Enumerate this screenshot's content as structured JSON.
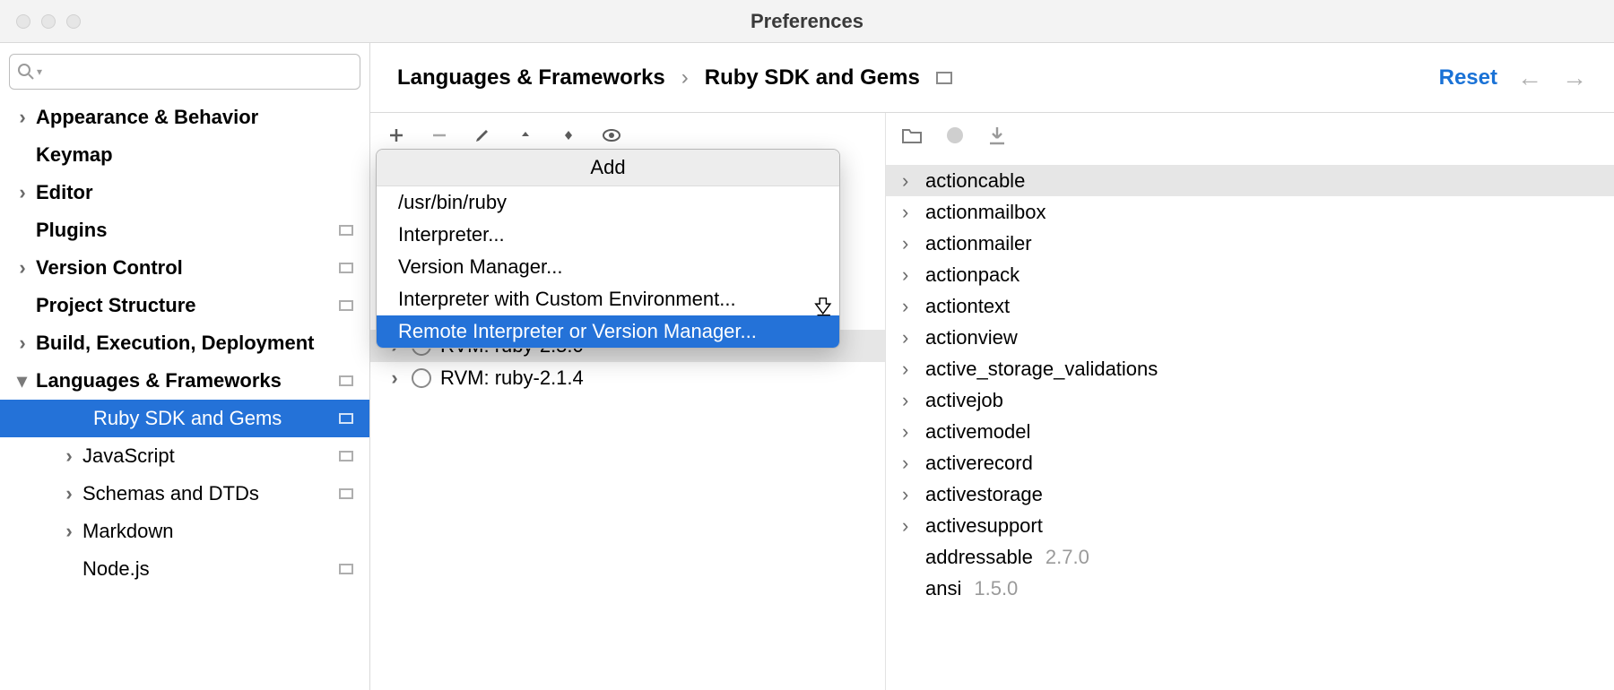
{
  "window": {
    "title": "Preferences"
  },
  "sidebar": {
    "items": [
      {
        "label": "Appearance & Behavior",
        "chevron": "right",
        "bold": true
      },
      {
        "label": "Keymap",
        "chevron": "none",
        "bold": true
      },
      {
        "label": "Editor",
        "chevron": "right",
        "bold": true
      },
      {
        "label": "Plugins",
        "chevron": "none",
        "bold": true,
        "box": true
      },
      {
        "label": "Version Control",
        "chevron": "right",
        "bold": true,
        "box": true
      },
      {
        "label": "Project Structure",
        "chevron": "none",
        "bold": true,
        "box": true
      },
      {
        "label": "Build, Execution, Deployment",
        "chevron": "right",
        "bold": true
      },
      {
        "label": "Languages & Frameworks",
        "chevron": "down",
        "bold": true,
        "box": true
      },
      {
        "label": "Ruby SDK and Gems",
        "chevron": "none",
        "selected": true,
        "box": true,
        "child": true
      },
      {
        "label": "JavaScript",
        "chevron": "right",
        "child": true,
        "box": true
      },
      {
        "label": "Schemas and DTDs",
        "chevron": "right",
        "child": true,
        "box": true
      },
      {
        "label": "Markdown",
        "chevron": "right",
        "child": true
      },
      {
        "label": "Node.js",
        "chevron": "none",
        "child": true,
        "box": true
      }
    ]
  },
  "header": {
    "crumb1": "Languages & Frameworks",
    "separator": "›",
    "crumb2": "Ruby SDK and Gems",
    "reset": "Reset"
  },
  "popup": {
    "title": "Add",
    "items": [
      {
        "label": "/usr/bin/ruby"
      },
      {
        "label": "Interpreter..."
      },
      {
        "label": "Version Manager..."
      },
      {
        "label": "Interpreter with Custom Environment..."
      },
      {
        "label": "Remote Interpreter or Version Manager...",
        "selected": true
      }
    ]
  },
  "sdk_rows": [
    {
      "label": "RVM: ruby-2.5.0",
      "highlight": true,
      "obscured": true
    },
    {
      "label": "RVM: ruby-2.1.4"
    }
  ],
  "gems": [
    {
      "name": "actioncable",
      "chevron": true,
      "sel": true
    },
    {
      "name": "actionmailbox",
      "chevron": true
    },
    {
      "name": "actionmailer",
      "chevron": true
    },
    {
      "name": "actionpack",
      "chevron": true
    },
    {
      "name": "actiontext",
      "chevron": true
    },
    {
      "name": "actionview",
      "chevron": true
    },
    {
      "name": "active_storage_validations",
      "chevron": true
    },
    {
      "name": "activejob",
      "chevron": true
    },
    {
      "name": "activemodel",
      "chevron": true
    },
    {
      "name": "activerecord",
      "chevron": true
    },
    {
      "name": "activestorage",
      "chevron": true
    },
    {
      "name": "activesupport",
      "chevron": true
    },
    {
      "name": "addressable",
      "version": "2.7.0"
    },
    {
      "name": "ansi",
      "version": "1.5.0"
    }
  ]
}
